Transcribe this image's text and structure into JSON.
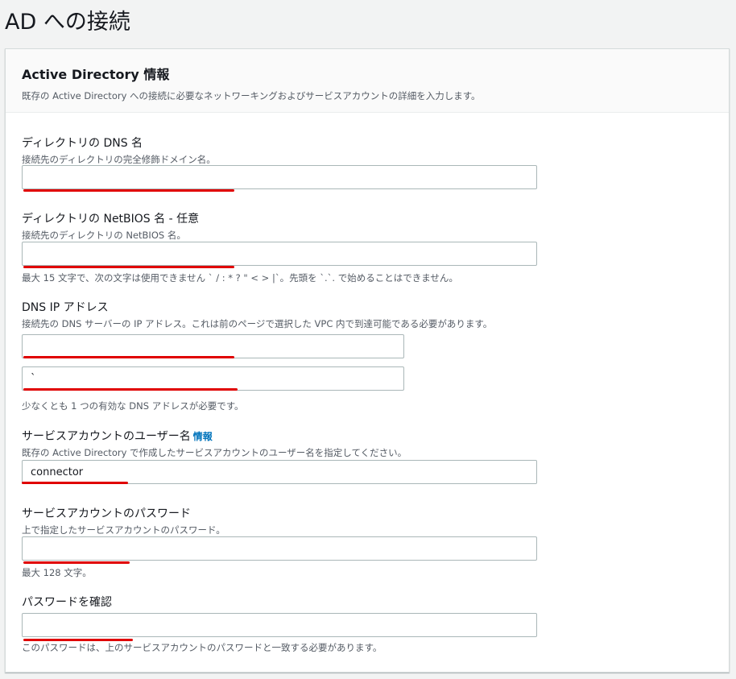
{
  "page": {
    "title": "AD への接続"
  },
  "panel": {
    "title": "Active Directory 情報",
    "description": "既存の Active Directory への接続に必要なネットワーキングおよびサービスアカウントの詳細を入力します。"
  },
  "fields": {
    "dns_name": {
      "label": "ディレクトリの DNS 名",
      "description": "接続先のディレクトリの完全修飾ドメイン名。",
      "value": ""
    },
    "netbios_name": {
      "label": "ディレクトリの NetBIOS 名 - 任意",
      "description": "接続先のディレクトリの NetBIOS 名。",
      "value": "",
      "constraint": "最大 15 文字で、次の文字は使用できません ` / : * ? \" < > |`。先頭を `.`. で始めることはできません。"
    },
    "dns_ip": {
      "label": "DNS IP アドレス",
      "description": "接続先の DNS サーバーの IP アドレス。これは前のページで選択した VPC 内で到達可能である必要があります。",
      "value_1": "",
      "value_2": "`",
      "constraint": "少なくとも 1 つの有効な DNS アドレスが必要です。"
    },
    "service_account_user": {
      "label": "サービスアカウントのユーザー名",
      "info_link": "情報",
      "description": "既存の Active Directory で作成したサービスアカウントのユーザー名を指定してください。",
      "value": "connector"
    },
    "service_account_password": {
      "label": "サービスアカウントのパスワード",
      "description": "上で指定したサービスアカウントのパスワード。",
      "value": "",
      "constraint": "最大 128 文字。"
    },
    "confirm_password": {
      "label": "パスワードを確認",
      "value": "",
      "constraint": "このパスワードは、上のサービスアカウントのパスワードと一致する必要があります。"
    }
  },
  "colors": {
    "annotation_red": "#e00000",
    "link_blue": "#0073bb"
  }
}
